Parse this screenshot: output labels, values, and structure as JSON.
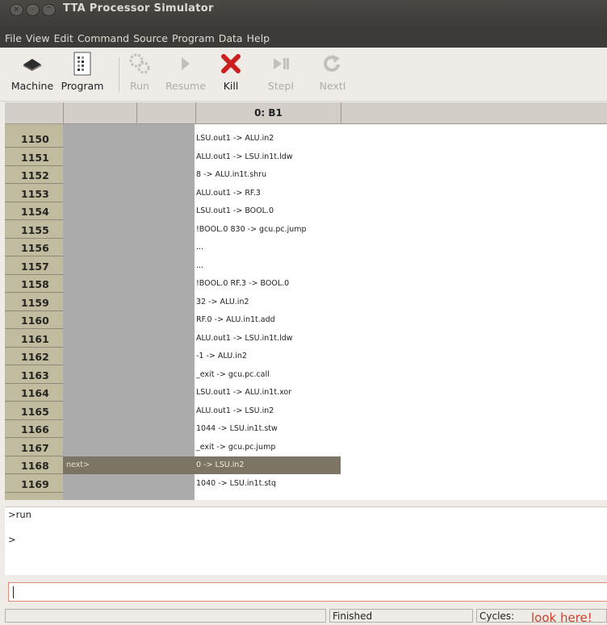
{
  "window": {
    "title": "TTA Processor Simulator"
  },
  "menu": [
    "File",
    "View",
    "Edit",
    "Command",
    "Source",
    "Program",
    "Data",
    "Help"
  ],
  "toolbar": {
    "machine": "Machine",
    "program": "Program",
    "run": "Run",
    "resume": "Resume",
    "kill": "Kill",
    "stepi": "StepI",
    "nexti": "NextI"
  },
  "grid": {
    "header": "0: B1",
    "current_marker": "next>",
    "rows": [
      {
        "line": "1150",
        "instr": "LSU.out1 -> ALU.in2"
      },
      {
        "line": "1151",
        "instr": "ALU.out1 -> LSU.in1t.ldw"
      },
      {
        "line": "1152",
        "instr": "8 -> ALU.in1t.shru"
      },
      {
        "line": "1153",
        "instr": "ALU.out1 -> RF.3"
      },
      {
        "line": "1154",
        "instr": "LSU.out1 -> BOOL.0"
      },
      {
        "line": "1155",
        "instr": "!BOOL.0 830 -> gcu.pc.jump"
      },
      {
        "line": "1156",
        "instr": "..."
      },
      {
        "line": "1157",
        "instr": "..."
      },
      {
        "line": "1158",
        "instr": "!BOOL.0 RF.3 -> BOOL.0"
      },
      {
        "line": "1159",
        "instr": "32 -> ALU.in2"
      },
      {
        "line": "1160",
        "instr": "RF.0 -> ALU.in1t.add"
      },
      {
        "line": "1161",
        "instr": "ALU.out1 -> LSU.in1t.ldw"
      },
      {
        "line": "1162",
        "instr": "-1 -> ALU.in2"
      },
      {
        "line": "1163",
        "instr": "_exit -> gcu.pc.call"
      },
      {
        "line": "1164",
        "instr": "LSU.out1 -> ALU.in1t.xor"
      },
      {
        "line": "1165",
        "instr": "ALU.out1 -> LSU.in2"
      },
      {
        "line": "1166",
        "instr": "1044 -> LSU.in1t.stw"
      },
      {
        "line": "1167",
        "instr": "_exit -> gcu.pc.jump"
      },
      {
        "line": "1168",
        "instr": "0 -> LSU.in2"
      },
      {
        "line": "1169",
        "instr": "1040 -> LSU.in1t.stq"
      }
    ]
  },
  "console": {
    "line1": ">run",
    "line2": ">"
  },
  "command_input": {
    "value": ""
  },
  "status": {
    "state": "Finished",
    "cycles_label": "Cycles:"
  },
  "overlay": {
    "text": "look here!"
  }
}
